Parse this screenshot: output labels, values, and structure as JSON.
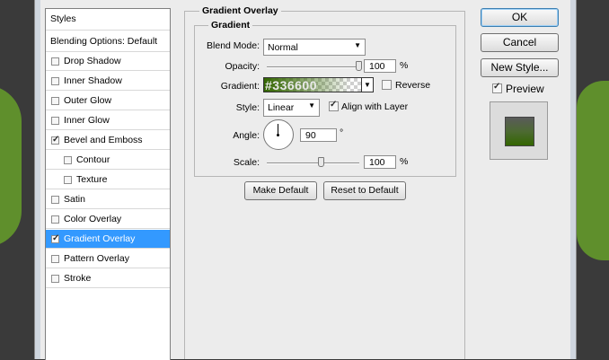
{
  "colors": {
    "selection": "#3399ff",
    "background_green": "#5a8a2a",
    "gradient_start": "#336600"
  },
  "left_panel": {
    "styles_label": "Styles",
    "blending_label": "Blending Options: Default",
    "items": [
      {
        "label": "Drop Shadow",
        "checked": false,
        "icon": "checkbox"
      },
      {
        "label": "Inner Shadow",
        "checked": false,
        "icon": "checkbox"
      },
      {
        "label": "Outer Glow",
        "checked": false,
        "icon": "checkbox"
      },
      {
        "label": "Inner Glow",
        "checked": false,
        "icon": "checkbox"
      },
      {
        "label": "Bevel and Emboss",
        "checked": true,
        "icon": "checkbox"
      },
      {
        "label": "Contour",
        "checked": false,
        "icon": "checkbox"
      },
      {
        "label": "Texture",
        "checked": false,
        "icon": "checkbox"
      },
      {
        "label": "Satin",
        "checked": false,
        "icon": "checkbox"
      },
      {
        "label": "Color Overlay",
        "checked": false,
        "icon": "checkbox"
      },
      {
        "label": "Gradient Overlay",
        "checked": true,
        "icon": "checkbox",
        "selected": true
      },
      {
        "label": "Pattern Overlay",
        "checked": false,
        "icon": "checkbox"
      },
      {
        "label": "Stroke",
        "checked": false,
        "icon": "checkbox"
      }
    ]
  },
  "main": {
    "section_title": "Gradient Overlay",
    "group_title": "Gradient",
    "blend_mode": {
      "label": "Blend Mode:",
      "value": "Normal"
    },
    "opacity": {
      "label": "Opacity:",
      "value": "100",
      "unit": "%",
      "level": 1.0
    },
    "gradient": {
      "label": "Gradient:",
      "text": "#336600",
      "reverse_label": "Reverse",
      "reverse_checked": false
    },
    "style": {
      "label": "Style:",
      "value": "Linear",
      "align_label": "Align with Layer",
      "align_checked": true
    },
    "angle": {
      "label": "Angle:",
      "value": "90",
      "unit": "°"
    },
    "scale": {
      "label": "Scale:",
      "value": "100",
      "unit": "%",
      "level": 0.5
    },
    "make_default": "Make Default",
    "reset_default": "Reset to Default"
  },
  "right": {
    "ok": "OK",
    "cancel": "Cancel",
    "new_style": "New Style...",
    "preview_label": "Preview",
    "preview_checked": true
  }
}
